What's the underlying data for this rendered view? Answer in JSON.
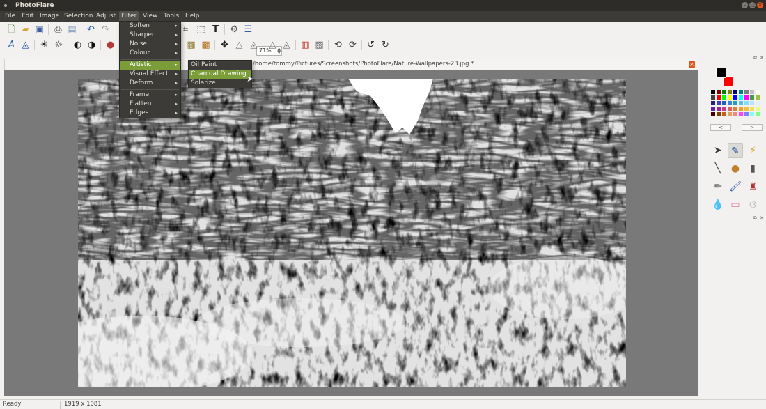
{
  "window": {
    "title": "PhotoFlare"
  },
  "menubar": [
    "File",
    "Edit",
    "Image",
    "Selection",
    "Adjust",
    "Filter",
    "View",
    "Tools",
    "Help"
  ],
  "zoom": {
    "value": "71%"
  },
  "document": {
    "title": "/home/tommy/Pictures/Screenshots/PhotoFlare/Nature-Wallpapers-23.jpg *"
  },
  "filter_menu": {
    "items": [
      "Soften",
      "Sharpen",
      "Noise",
      "Colour",
      "Artistic",
      "Visual Effect",
      "Deform",
      "Frame",
      "Flatten",
      "Edges"
    ],
    "highlighted": "Artistic"
  },
  "artistic_submenu": {
    "items": [
      "Oil Paint",
      "Charcoal Drawing",
      "Solarize"
    ],
    "highlighted": "Charcoal Drawing"
  },
  "palette": {
    "primary": "#000000",
    "secondary": "#ff0000",
    "prev_label": "<",
    "next_label": ">"
  },
  "status": {
    "ready": "Ready",
    "image_size": "1919 x 1081"
  }
}
